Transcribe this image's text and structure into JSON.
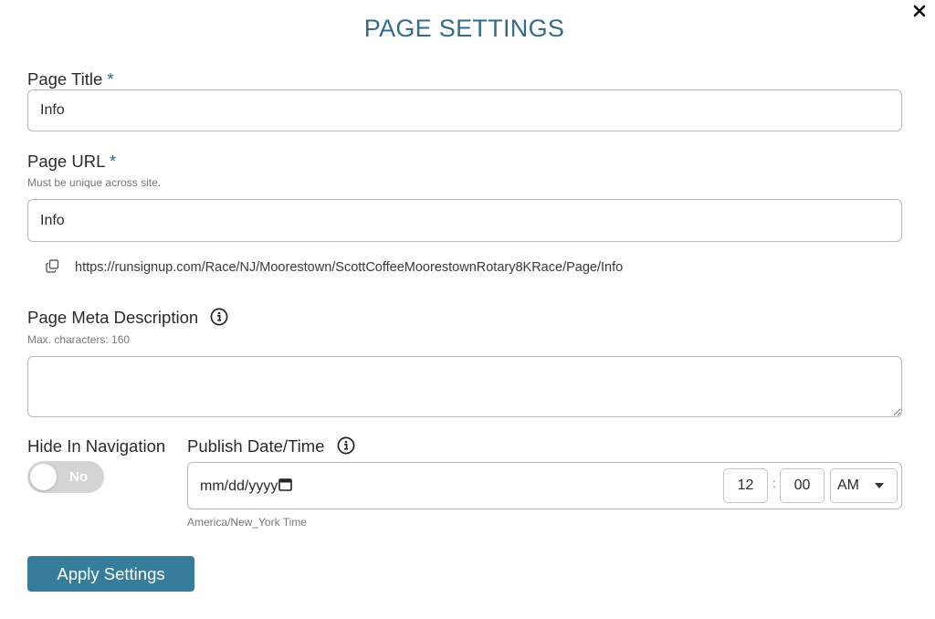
{
  "dialog": {
    "title": "PAGE SETTINGS",
    "close_icon": "close-icon"
  },
  "fields": {
    "required_marker": "*",
    "page_title": {
      "label": "Page Title",
      "value": "Info"
    },
    "page_url": {
      "label": "Page URL",
      "hint": "Must be unique across site.",
      "value": "Info",
      "full_url": "https://runsignup.com/Race/NJ/Moorestown/ScottCoffeeMoorestownRotary8KRace/Page/Info",
      "copy_icon": "copy-icon"
    },
    "meta_description": {
      "label": "Page Meta Description",
      "hint": "Max. characters: 160",
      "value": "",
      "info_icon": "info-icon"
    },
    "hide_in_navigation": {
      "label": "Hide In Navigation",
      "state_text": "No"
    },
    "publish": {
      "label": "Publish Date/Time",
      "info_icon": "info-icon",
      "date_placeholder": "mm/dd/yyyy",
      "hour": "12",
      "minute": "00",
      "separator": ":",
      "ampm": "AM",
      "timezone": "America/New_York Time",
      "calendar_icon": "calendar-icon"
    }
  },
  "actions": {
    "apply_label": "Apply Settings"
  },
  "colors": {
    "accent": "#336d8c",
    "button": "#367d9c",
    "toggle_off": "#d4d4d4"
  }
}
